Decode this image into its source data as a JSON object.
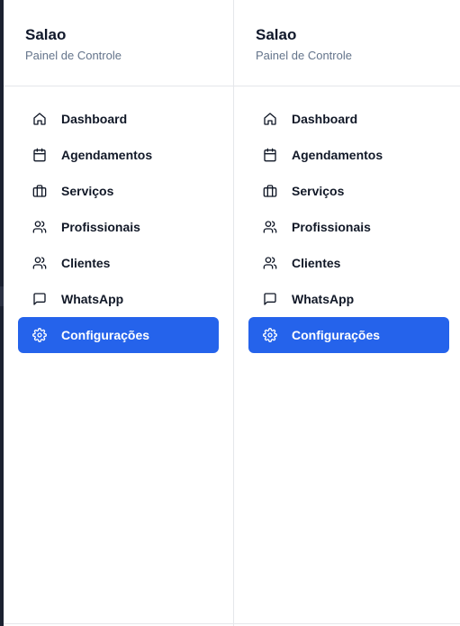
{
  "panels": [
    {
      "brand": {
        "title": "Salao",
        "subtitle": "Painel de Controle"
      },
      "nav": [
        {
          "label": "Dashboard",
          "icon": "home-icon",
          "active": false
        },
        {
          "label": "Agendamentos",
          "icon": "calendar-icon",
          "active": false
        },
        {
          "label": "Serviços",
          "icon": "briefcase-icon",
          "active": false
        },
        {
          "label": "Profissionais",
          "icon": "users-icon",
          "active": false
        },
        {
          "label": "Clientes",
          "icon": "users-icon",
          "active": false
        },
        {
          "label": "WhatsApp",
          "icon": "message-square-icon",
          "active": false
        },
        {
          "label": "Configurações",
          "icon": "gear-icon",
          "active": true
        }
      ]
    },
    {
      "brand": {
        "title": "Salao",
        "subtitle": "Painel de Controle"
      },
      "nav": [
        {
          "label": "Dashboard",
          "icon": "home-icon",
          "active": false
        },
        {
          "label": "Agendamentos",
          "icon": "calendar-icon",
          "active": false
        },
        {
          "label": "Serviços",
          "icon": "briefcase-icon",
          "active": false
        },
        {
          "label": "Profissionais",
          "icon": "users-icon",
          "active": false
        },
        {
          "label": "Clientes",
          "icon": "users-icon",
          "active": false
        },
        {
          "label": "WhatsApp",
          "icon": "message-square-icon",
          "active": false
        },
        {
          "label": "Configurações",
          "icon": "gear-icon",
          "active": true
        }
      ]
    }
  ],
  "colors": {
    "accent": "#2563eb",
    "text": "#111827",
    "muted": "#64748b",
    "border": "#e5e7eb",
    "left_edge": "#1b2130"
  }
}
